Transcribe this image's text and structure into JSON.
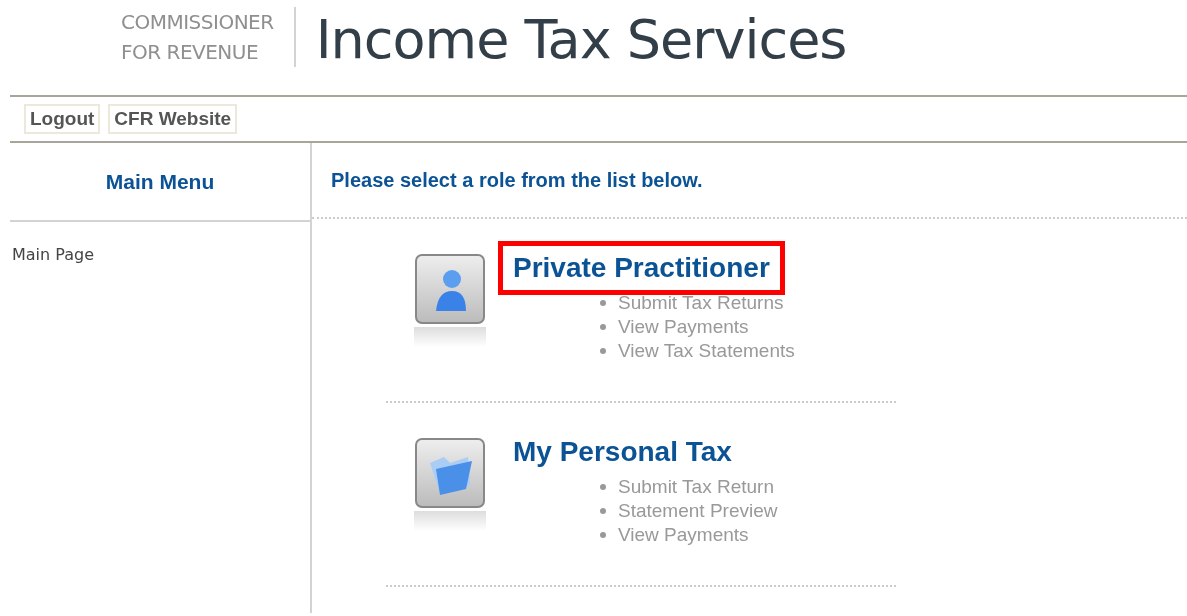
{
  "header": {
    "brand_lines": [
      "COMMISSIONER",
      "FOR REVENUE"
    ],
    "title": "Income Tax Services"
  },
  "nav": [
    {
      "label": "Logout"
    },
    {
      "label": "CFR Website"
    }
  ],
  "sidebar": {
    "title": "Main Menu",
    "items": [
      {
        "label": "Main Page"
      }
    ]
  },
  "main": {
    "heading": "Please select a role from the list below.",
    "roles": [
      {
        "kind": "person",
        "title": "Private Practitioner",
        "highlighted": true,
        "items": [
          "Submit Tax Returns",
          "View Payments",
          "View Tax Statements"
        ]
      },
      {
        "kind": "folder",
        "title": "My Personal Tax",
        "highlighted": false,
        "items": [
          "Submit Tax Return",
          "Statement Preview",
          "View Payments"
        ]
      }
    ]
  }
}
